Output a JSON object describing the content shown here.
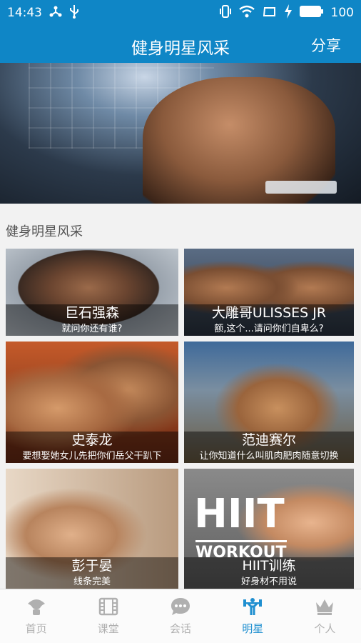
{
  "status_bar": {
    "time": "14:43",
    "battery": "100"
  },
  "app_bar": {
    "title": "健身明星风采",
    "share_label": "分享"
  },
  "section": {
    "title": "健身明星风采"
  },
  "cards": [
    {
      "name": "巨石强森",
      "desc": "就问你还有谁?"
    },
    {
      "name": "大雕哥ULISSES JR",
      "desc": "额,这个...请问你们自卑么?"
    },
    {
      "name": "史泰龙",
      "desc": "要想娶她女儿先把你们岳父干趴下"
    },
    {
      "name": "范迪赛尔",
      "desc": "让你知道什么叫肌肉肥肉随意切换"
    },
    {
      "name": "彭于晏",
      "desc": "线条完美"
    },
    {
      "name": "HIIT训练",
      "desc": "好身材不用说",
      "poster_text": [
        "HIIT",
        "WORKOUT"
      ]
    }
  ],
  "tabs": [
    {
      "label": "首页",
      "icon": "home-icon"
    },
    {
      "label": "课堂",
      "icon": "film-icon"
    },
    {
      "label": "会话",
      "icon": "chat-icon"
    },
    {
      "label": "明星",
      "icon": "weightlifter-icon",
      "active": true
    },
    {
      "label": "个人",
      "icon": "crown-icon"
    }
  ],
  "colors": {
    "primary": "#0f86c6",
    "active_tab": "#1f8fd0",
    "inactive_tab": "#b0b0b0"
  }
}
